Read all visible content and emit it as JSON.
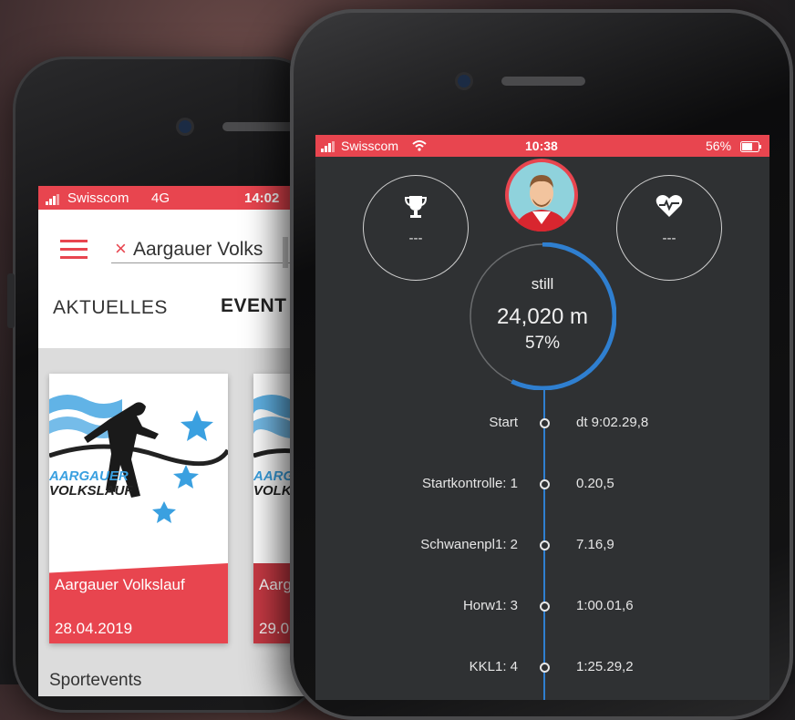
{
  "back_phone": {
    "status_bar": {
      "carrier": "Swisscom",
      "network": "4G",
      "time": "14:02"
    },
    "search_chip": {
      "close_glyph": "×",
      "text": "Aargauer Volks"
    },
    "tabs": [
      {
        "label": "AKTUELLES"
      },
      {
        "label": "EVENT"
      }
    ],
    "cards": [
      {
        "logo_line1": "AARGAUER",
        "logo_line2": "VOLKSLAUF",
        "title": "Aargauer Volkslauf",
        "date": "28.04.2019"
      },
      {
        "logo_line1": "AARG",
        "logo_line2": "VOLK",
        "title": "Aarg",
        "date": "29.0"
      }
    ],
    "section_heading": "Sportevents"
  },
  "front_phone": {
    "status_bar": {
      "carrier": "Swisscom",
      "time": "10:38",
      "battery": "56%"
    },
    "rank_value": "---",
    "heart_value": "---",
    "progress": {
      "state": "still",
      "distance": "24,020 m",
      "percent_label": "57%",
      "percent": 57
    },
    "timeline": [
      {
        "label": "Start",
        "value": "dt 9:02.29,8"
      },
      {
        "label": "Startkontrolle: 1",
        "value": "0.20,5"
      },
      {
        "label": "Schwanenpl1: 2",
        "value": "7.16,9"
      },
      {
        "label": "Horw1: 3",
        "value": "1:00.01,6"
      },
      {
        "label": "KKL1: 4",
        "value": "1:25.29,2"
      }
    ]
  },
  "colors": {
    "accent": "#e8454f",
    "progress_arc": "#2f7fd0",
    "dark_bg": "#2f3133",
    "star_blue": "#3aa0e0"
  },
  "icons": [
    "signal-icon",
    "wifi-icon",
    "battery-icon",
    "hamburger-menu-icon",
    "close-icon",
    "trophy-icon",
    "heart-rate-icon",
    "avatar"
  ]
}
